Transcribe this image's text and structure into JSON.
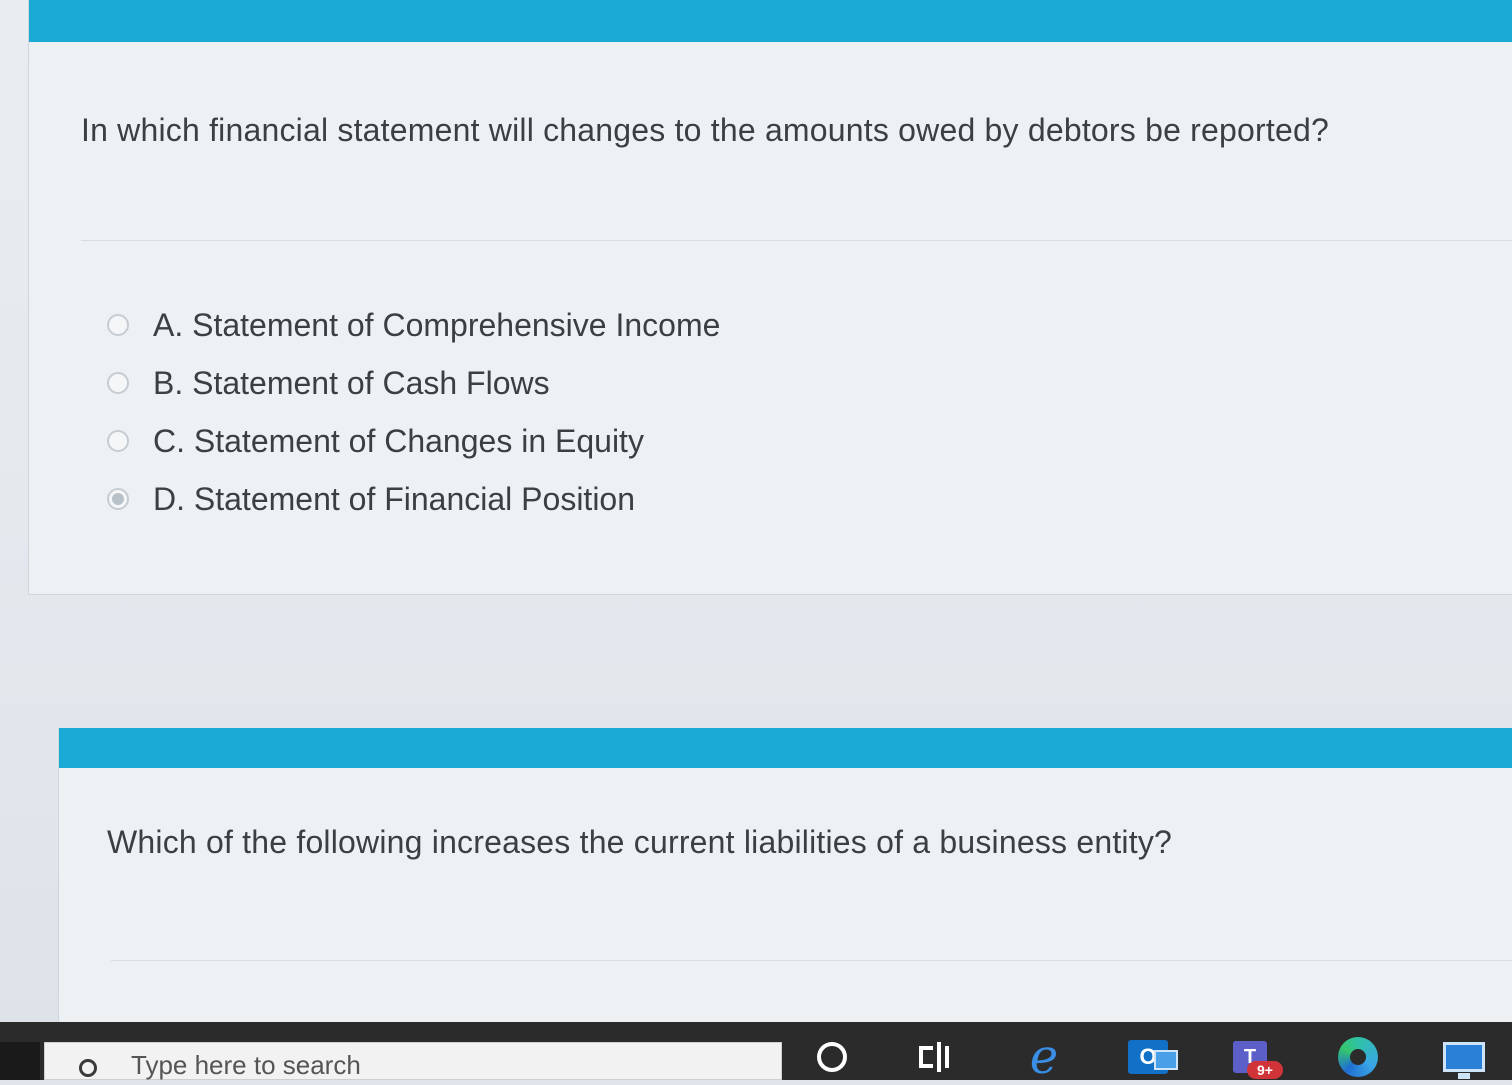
{
  "questions": [
    {
      "text": "In which financial statement will changes to the amounts owed by debtors be reported?",
      "options": [
        {
          "label": "A. Statement of Comprehensive Income",
          "selected": false
        },
        {
          "label": "B. Statement of Cash Flows",
          "selected": false
        },
        {
          "label": "C. Statement of Changes in Equity",
          "selected": false
        },
        {
          "label": "D. Statement of Financial Position",
          "selected": true
        }
      ]
    },
    {
      "text": "Which of the following increases the current liabilities of a business entity?"
    }
  ],
  "taskbar": {
    "search_placeholder": "Type here to search",
    "teams_letter": "T",
    "teams_badge": "9+",
    "outlook_letter": "O"
  },
  "colors": {
    "accent": "#1ba9d6",
    "text": "#3a3f44",
    "taskbar": "#2b2b2b"
  }
}
